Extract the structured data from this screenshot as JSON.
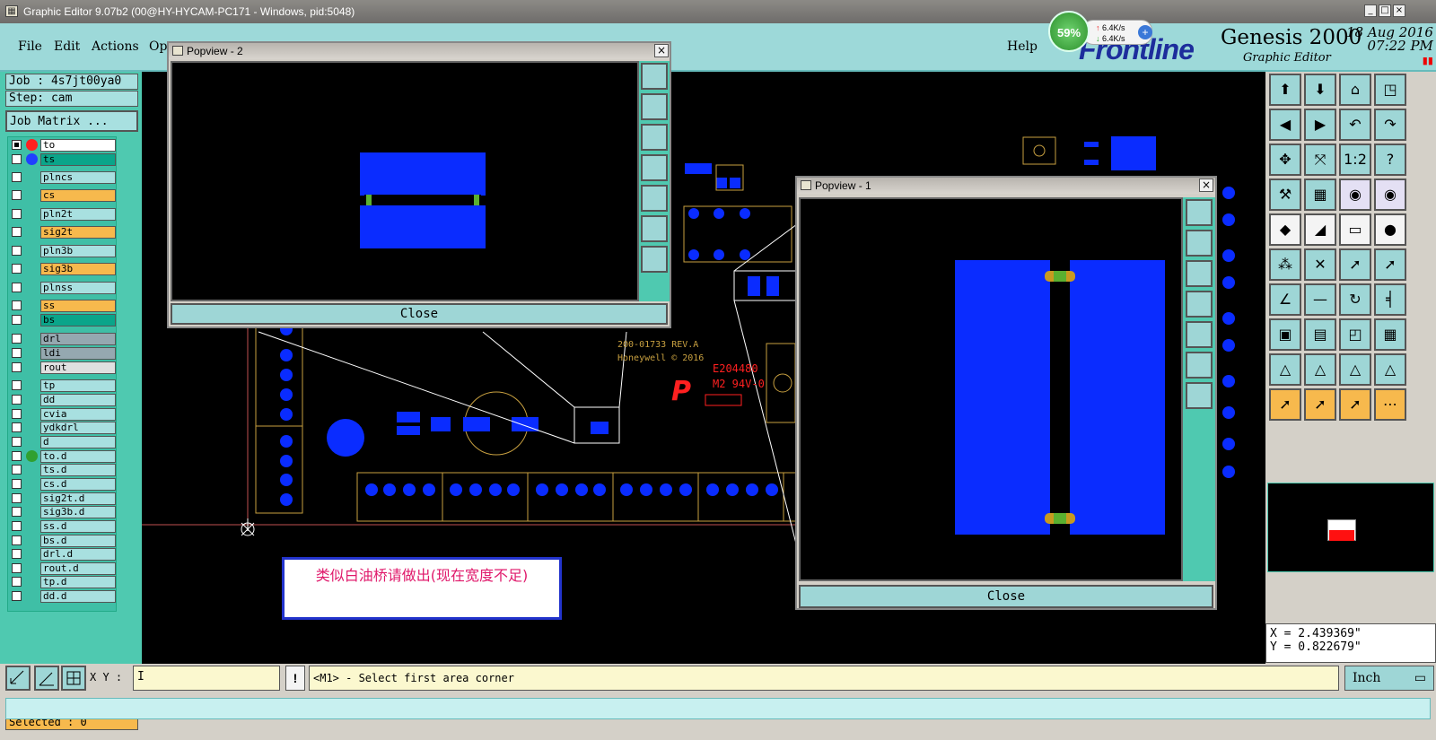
{
  "window": {
    "title": "Graphic Editor 9.07b2 (00@HY-HYCAM-PC171 - Windows, pid:5048)",
    "min": "_",
    "max": "□",
    "close": "×"
  },
  "menu": {
    "file": "File",
    "edit": "Edit",
    "actions": "Actions",
    "options": "Opt",
    "help": "Help"
  },
  "logo": {
    "brand": "Frontline",
    "product": "Genesis 2000",
    "subtitle": "Graphic Editor",
    "date": "18 Aug 2016",
    "time": "07:22 PM"
  },
  "network": {
    "percent": "59%",
    "up": "6.4K/s",
    "down": "6.4K/s"
  },
  "job": {
    "job": "Job : 4s7jt00ya0",
    "step": "Step: cam",
    "matrix": "Job Matrix ..."
  },
  "layers": [
    {
      "name": "to",
      "dot": "#ff2020",
      "bg": "#ffffff",
      "checked": true
    },
    {
      "name": "ts",
      "dot": "#2040ff",
      "bg": "#0aa58a",
      "checked": false
    },
    {
      "name": "plncs",
      "dot": "",
      "bg": "#a8e0e0",
      "checked": false
    },
    {
      "name": "cs",
      "dot": "",
      "bg": "#f7b94d",
      "checked": false
    },
    {
      "name": "pln2t",
      "dot": "",
      "bg": "#a8e0e0",
      "checked": false
    },
    {
      "name": "sig2t",
      "dot": "",
      "bg": "#f7b94d",
      "checked": false
    },
    {
      "name": "pln3b",
      "dot": "",
      "bg": "#a8e0e0",
      "checked": false
    },
    {
      "name": "sig3b",
      "dot": "",
      "bg": "#f7b94d",
      "checked": false
    },
    {
      "name": "plnss",
      "dot": "",
      "bg": "#a8e0e0",
      "checked": false
    },
    {
      "name": "ss",
      "dot": "",
      "bg": "#f7b94d",
      "checked": false
    },
    {
      "name": "bs",
      "dot": "",
      "bg": "#0aa58a",
      "checked": false
    },
    {
      "name": "drl",
      "dot": "",
      "bg": "#95a8b0",
      "checked": false
    },
    {
      "name": "ldi",
      "dot": "",
      "bg": "#95a8b0",
      "checked": false
    },
    {
      "name": "rout",
      "dot": "",
      "bg": "#e0e0e0",
      "checked": false
    },
    {
      "name": "tp",
      "dot": "",
      "bg": "#a8e0e0",
      "checked": false
    },
    {
      "name": "dd",
      "dot": "",
      "bg": "#a8e0e0",
      "checked": false
    },
    {
      "name": "cvia",
      "dot": "",
      "bg": "#a8e0e0",
      "checked": false
    },
    {
      "name": "ydkdrl",
      "dot": "",
      "bg": "#a8e0e0",
      "checked": false
    },
    {
      "name": "d",
      "dot": "",
      "bg": "#a8e0e0",
      "checked": false
    },
    {
      "name": "to.d",
      "dot": "#30a030",
      "bg": "#a8e0e0",
      "checked": false
    },
    {
      "name": "ts.d",
      "dot": "",
      "bg": "#a8e0e0",
      "checked": false
    },
    {
      "name": "cs.d",
      "dot": "",
      "bg": "#a8e0e0",
      "checked": false
    },
    {
      "name": "sig2t.d",
      "dot": "",
      "bg": "#a8e0e0",
      "checked": false
    },
    {
      "name": "sig3b.d",
      "dot": "",
      "bg": "#a8e0e0",
      "checked": false
    },
    {
      "name": "ss.d",
      "dot": "",
      "bg": "#a8e0e0",
      "checked": false
    },
    {
      "name": "bs.d",
      "dot": "",
      "bg": "#a8e0e0",
      "checked": false
    },
    {
      "name": "drl.d",
      "dot": "",
      "bg": "#a8e0e0",
      "checked": false
    },
    {
      "name": "rout.d",
      "dot": "",
      "bg": "#a8e0e0",
      "checked": false
    },
    {
      "name": "tp.d",
      "dot": "",
      "bg": "#a8e0e0",
      "checked": false
    },
    {
      "name": "dd.d",
      "dot": "",
      "bg": "#a8e0e0",
      "checked": false
    }
  ],
  "selected": "Selected : 0",
  "canvas": {
    "label1": "200-01733 REV.A",
    "label2": "Honeywell © 2016",
    "ul1": "E204480",
    "ul2": "M2 94V-0",
    "note": "类似白油桥请做出(现在宽度不足)"
  },
  "popup2": {
    "title": "Popview - 2",
    "close": "Close"
  },
  "popup1": {
    "title": "Popview - 1",
    "close": "Close"
  },
  "coords": {
    "x": "X = 2.439369\"",
    "y": "Y = 0.822679\""
  },
  "bottom": {
    "xy_label": "X Y :",
    "xy_value": "I",
    "warn": "!",
    "message": "<M1> - Select first area corner",
    "unit": "Inch"
  }
}
